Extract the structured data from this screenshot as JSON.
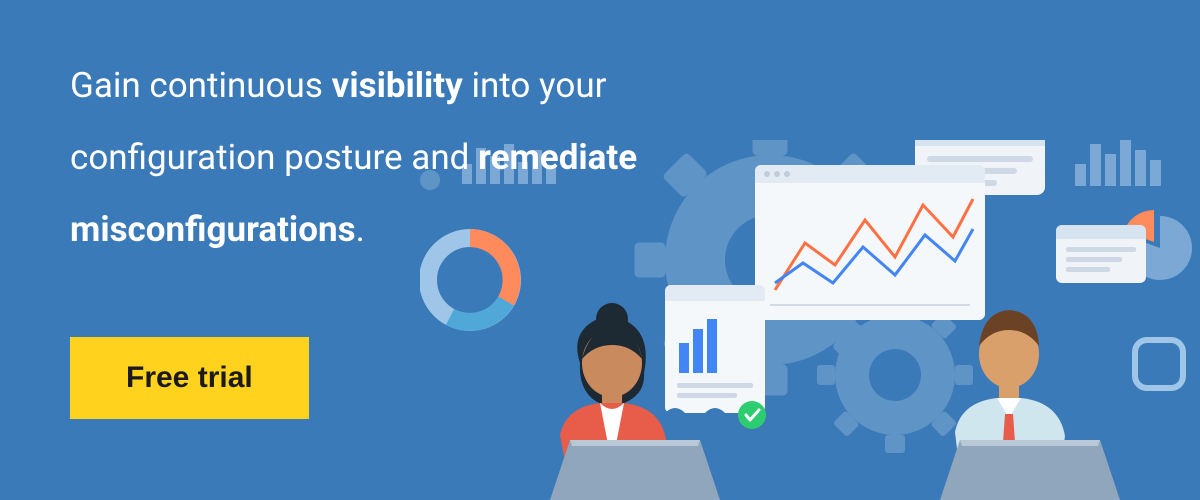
{
  "heading": {
    "part1": "Gain continuous ",
    "bold1": "visibility",
    "part2": " into your configuration posture and ",
    "bold2": "remediate misconfigurations",
    "part3": "."
  },
  "cta_label": "Free trial",
  "colors": {
    "background": "#3b7ab8",
    "cta_bg": "#ffd21e",
    "cta_text": "#1a1a1a",
    "heading_text": "#ffffff"
  },
  "illustration": {
    "description": "Two people working at laptops with analytics dashboards, gears, and charts behind them",
    "icons": [
      "gear-icon",
      "bar-chart-icon",
      "donut-chart-icon",
      "pie-chart-icon",
      "dashboard-icon",
      "line-chart-icon",
      "dialog-box-icon",
      "document-icon",
      "checkmark-badge-icon",
      "laptop-icon"
    ]
  }
}
